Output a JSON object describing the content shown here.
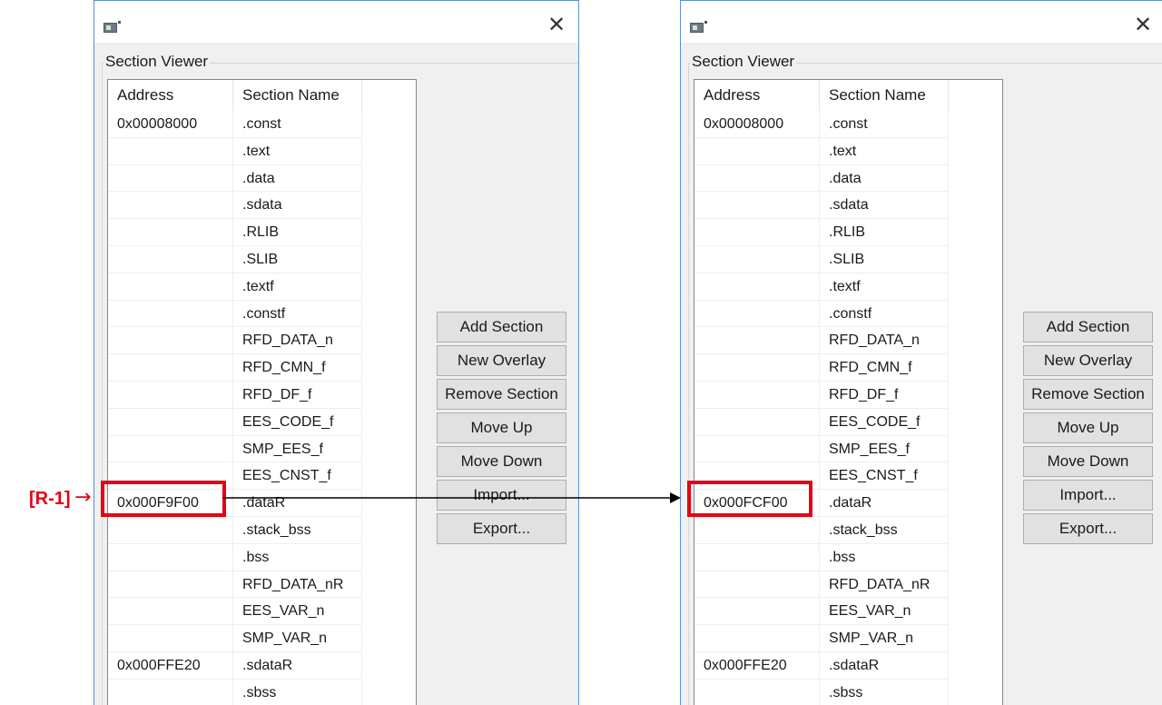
{
  "annotation": {
    "label": "[R-1]",
    "arrow": "→"
  },
  "windows": [
    {
      "group_label": "Section Viewer",
      "columns": [
        "Address",
        "Section Name"
      ],
      "rows": [
        {
          "address": "0x00008000",
          "name": ".const"
        },
        {
          "address": "",
          "name": ".text"
        },
        {
          "address": "",
          "name": ".data"
        },
        {
          "address": "",
          "name": ".sdata"
        },
        {
          "address": "",
          "name": ".RLIB"
        },
        {
          "address": "",
          "name": ".SLIB"
        },
        {
          "address": "",
          "name": ".textf"
        },
        {
          "address": "",
          "name": ".constf"
        },
        {
          "address": "",
          "name": "RFD_DATA_n"
        },
        {
          "address": "",
          "name": "RFD_CMN_f"
        },
        {
          "address": "",
          "name": "RFD_DF_f"
        },
        {
          "address": "",
          "name": "EES_CODE_f"
        },
        {
          "address": "",
          "name": "SMP_EES_f"
        },
        {
          "address": "",
          "name": "EES_CNST_f"
        },
        {
          "address": "0x000F9F00",
          "name": ".dataR"
        },
        {
          "address": "",
          "name": ".stack_bss"
        },
        {
          "address": "",
          "name": ".bss"
        },
        {
          "address": "",
          "name": "RFD_DATA_nR"
        },
        {
          "address": "",
          "name": "EES_VAR_n"
        },
        {
          "address": "",
          "name": "SMP_VAR_n"
        },
        {
          "address": "0x000FFE20",
          "name": ".sdataR"
        },
        {
          "address": "",
          "name": ".sbss"
        }
      ],
      "buttons": [
        "Add Section",
        "New Overlay",
        "Remove Section",
        "Move Up",
        "Move Down",
        "Import...",
        "Export..."
      ]
    },
    {
      "group_label": "Section Viewer",
      "columns": [
        "Address",
        "Section Name"
      ],
      "rows": [
        {
          "address": "0x00008000",
          "name": ".const"
        },
        {
          "address": "",
          "name": ".text"
        },
        {
          "address": "",
          "name": ".data"
        },
        {
          "address": "",
          "name": ".sdata"
        },
        {
          "address": "",
          "name": ".RLIB"
        },
        {
          "address": "",
          "name": ".SLIB"
        },
        {
          "address": "",
          "name": ".textf"
        },
        {
          "address": "",
          "name": ".constf"
        },
        {
          "address": "",
          "name": "RFD_DATA_n"
        },
        {
          "address": "",
          "name": "RFD_CMN_f"
        },
        {
          "address": "",
          "name": "RFD_DF_f"
        },
        {
          "address": "",
          "name": "EES_CODE_f"
        },
        {
          "address": "",
          "name": "SMP_EES_f"
        },
        {
          "address": "",
          "name": "EES_CNST_f"
        },
        {
          "address": "0x000FCF00",
          "name": ".dataR"
        },
        {
          "address": "",
          "name": ".stack_bss"
        },
        {
          "address": "",
          "name": ".bss"
        },
        {
          "address": "",
          "name": "RFD_DATA_nR"
        },
        {
          "address": "",
          "name": "EES_VAR_n"
        },
        {
          "address": "",
          "name": "SMP_VAR_n"
        },
        {
          "address": "0x000FFE20",
          "name": ".sdataR"
        },
        {
          "address": "",
          "name": ".sbss"
        }
      ],
      "buttons": [
        "Add Section",
        "New Overlay",
        "Remove Section",
        "Move Up",
        "Move Down",
        "Import...",
        "Export..."
      ]
    }
  ],
  "close_glyph": "✕",
  "colors": {
    "highlight": "#e60012",
    "window_border": "#5c8fcf",
    "window_bg": "#f0f0f0"
  },
  "icons": {
    "app": "app-window-icon",
    "close": "close-icon"
  }
}
